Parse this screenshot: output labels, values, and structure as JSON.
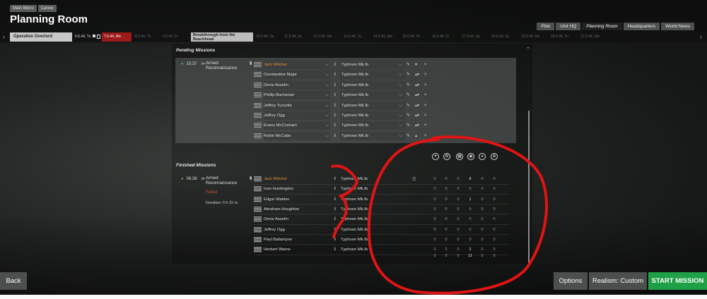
{
  "breadcrumb": {
    "items": [
      "Main Menu",
      "Career"
    ]
  },
  "page": {
    "title": "Planning Room"
  },
  "tabs": [
    "Pilot",
    "Unit HQ",
    "Planning Room",
    "Headquarters",
    "World News"
  ],
  "timeline": {
    "operation": "Operation Overlord",
    "dates": [
      "6.6.44, Tu",
      "7.6.44, We",
      "8.6.44, Th",
      "9.6.44, Fr",
      "10.6.44, Sa",
      "11.6.44, Su",
      "12.6.44, Mo",
      "13.6.44, Tu",
      "14.6.44, We",
      "15.6.44, Th",
      "16.6.44, Fr",
      "17.6.44, Sa",
      "18.6.44, Su",
      "19.6.44, Mo",
      "20.6.44, Tu",
      "21.6.44, We"
    ],
    "operation2": "Breakthrough from the Beachhead"
  },
  "pending": {
    "section_title": "Pending Missions",
    "mission": {
      "time": "15:37",
      "type": "Armed Reconnaissance",
      "pilots": [
        {
          "name": "Jack Witcher",
          "plane": "Typhoon Mk.Ib"
        },
        {
          "name": "Constantine Major",
          "plane": "Typhoon Mk.Ib"
        },
        {
          "name": "Denis Asselin",
          "plane": "Typhoon Mk.Ib"
        },
        {
          "name": "Phillip Buchanan",
          "plane": "Typhoon Mk.Ib"
        },
        {
          "name": "Jeffrey Turcotte",
          "plane": "Typhoon Mk.Ib"
        },
        {
          "name": "Jeffrey Ogg",
          "plane": "Typhoon Mk.Ib"
        },
        {
          "name": "Evans McCosham",
          "plane": "Typhoon Mk.Ib"
        },
        {
          "name": "Robin McCabe",
          "plane": "Typhoon Mk.Ib"
        }
      ]
    }
  },
  "finished": {
    "section_title": "Finished Missions",
    "mission": {
      "time": "06:38",
      "type": "Armed Reconnaissance",
      "status": "Failed",
      "duration": "Duration: 0 h 22 m",
      "pilots": [
        {
          "name": "Jack Witcher",
          "plane": "Typhoon Mk.Ib",
          "stats": [
            "0",
            "0",
            "0",
            "8",
            "0",
            "0"
          ]
        },
        {
          "name": "Ivan Huntingdon",
          "plane": "Typhoon Mk.Ib",
          "stats": [
            "0",
            "0",
            "0",
            "0",
            "0",
            "0"
          ]
        },
        {
          "name": "Edgar Waldon",
          "plane": "Typhoon Mk.Ib",
          "stats": [
            "0",
            "0",
            "0",
            "1",
            "0",
            "0"
          ]
        },
        {
          "name": "Abraham Houghton",
          "plane": "Typhoon Mk.Ib",
          "stats": [
            "0",
            "0",
            "0",
            "0",
            "0",
            "0"
          ]
        },
        {
          "name": "Denis Asselin",
          "plane": "Typhoon Mk.Ib",
          "stats": [
            "0",
            "0",
            "0",
            "0",
            "0",
            "0"
          ]
        },
        {
          "name": "Jeffrey Ogg",
          "plane": "Typhoon Mk.Ib",
          "stats": [
            "0",
            "0",
            "0",
            "0",
            "0",
            "0"
          ]
        },
        {
          "name": "Paul Ballantyne",
          "plane": "Typhoon Mk.Ib",
          "stats": [
            "0",
            "0",
            "0",
            "0",
            "0",
            "0"
          ]
        },
        {
          "name": "Herbert Warne",
          "plane": "Typhoon Mk.Ib",
          "stats": [
            "0",
            "0",
            "0",
            "2",
            "0",
            "0"
          ]
        }
      ],
      "totals": [
        "0",
        "0",
        "0",
        "11",
        "0",
        "0"
      ]
    }
  },
  "buttons": {
    "back": "Back",
    "options": "Options",
    "realism": "Realism: Custom",
    "start": "START MISSION"
  },
  "colors": {
    "leader": "#e58b3a",
    "failed": "#d2493a",
    "start": "#1fa047",
    "timeline_current": "#9b1a1a",
    "annotation": "#e01414"
  }
}
